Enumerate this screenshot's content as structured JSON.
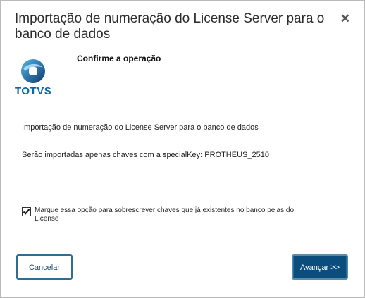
{
  "dialog": {
    "title": "Importação de numeração do License Server para o banco de dados",
    "close_glyph": "✕",
    "close_icon": "close-icon"
  },
  "logo": {
    "text": "TOTVS",
    "icon": "totvs-logo-icon",
    "brand_color": "#0a66a8"
  },
  "content": {
    "heading": "Confirme a operação",
    "description": "Importação de numeração do License Server para o banco de dados",
    "special_key_text": "Serão importadas apenas chaves com a specialKey: PROTHEUS_2510"
  },
  "overwrite_option": {
    "checked": true,
    "label": "Marque essa opção para sobrescrever chaves que já existentes no banco pelas do License"
  },
  "buttons": {
    "cancel_label": "Cancelar",
    "next_label": "Avançar >>"
  },
  "colors": {
    "primary_button": "#0b4e7e",
    "secondary_border": "#2f6d93"
  }
}
